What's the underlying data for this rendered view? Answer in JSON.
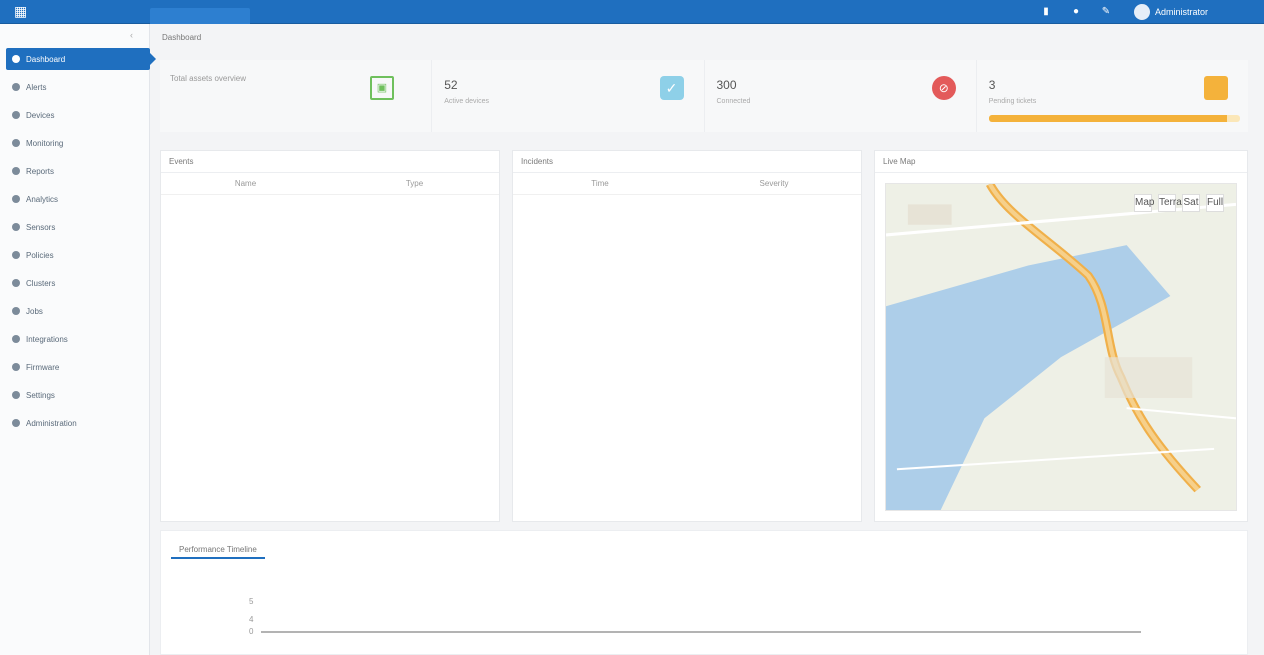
{
  "colors": {
    "primary": "#1f6fbf",
    "green": "#6fc05d",
    "teal": "#8ed0e8",
    "red": "#e35a5a",
    "orange": "#f4b23b"
  },
  "topbar": {
    "icons": [
      "chart-icon",
      "globe-icon",
      "settings-icon"
    ],
    "username": "Administrator"
  },
  "sidebar": {
    "items": [
      {
        "label": "Dashboard",
        "icon": "dashboard-icon",
        "active": true
      },
      {
        "label": "Alerts",
        "icon": "bell-icon"
      },
      {
        "label": "Devices",
        "icon": "device-icon"
      },
      {
        "label": "Monitoring",
        "icon": "monitor-icon"
      },
      {
        "label": "Reports",
        "icon": "report-icon"
      },
      {
        "label": "Analytics",
        "icon": "analytics-icon"
      },
      {
        "label": "Sensors",
        "icon": "sensor-icon"
      },
      {
        "label": "Policies",
        "icon": "policy-icon"
      },
      {
        "label": "Clusters",
        "icon": "cluster-icon"
      },
      {
        "label": "Jobs",
        "icon": "job-icon"
      },
      {
        "label": "Integrations",
        "icon": "plug-icon"
      },
      {
        "label": "Firmware",
        "icon": "chip-icon"
      },
      {
        "label": "Settings",
        "icon": "gear-icon"
      },
      {
        "label": "Administration",
        "icon": "admin-icon"
      }
    ]
  },
  "breadcrumb": "Dashboard",
  "stats": [
    {
      "title": "Total assets overview",
      "value": "",
      "caption": "",
      "icon": "frame-icon"
    },
    {
      "title": "",
      "value": "52",
      "caption": "Active devices",
      "icon": "check-icon"
    },
    {
      "title": "",
      "value": "300",
      "caption": "Connected",
      "icon": "stop-icon"
    },
    {
      "title": "",
      "value": "3",
      "caption": "Pending tickets",
      "icon": "bag-icon",
      "progress": 0.95
    }
  ],
  "panels": {
    "left": {
      "title": "Events",
      "columns": [
        "Name",
        "Type"
      ]
    },
    "middle": {
      "title": "Incidents",
      "columns": [
        "Time",
        "Severity"
      ]
    },
    "right": {
      "title": "Live Map",
      "controls": [
        "Map",
        "Terrain",
        "Sat",
        "Full"
      ]
    }
  },
  "bottom": {
    "tab": "Performance Timeline",
    "ylabels": [
      "5",
      "4",
      "0"
    ]
  }
}
